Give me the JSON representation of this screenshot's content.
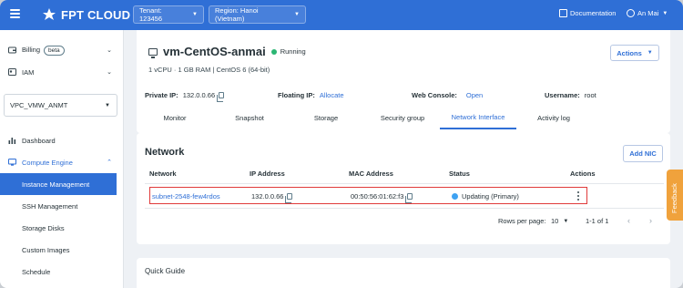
{
  "topbar": {
    "logo_text": "FPT CLOUD",
    "tenant_label": "Tenant: 123456",
    "region_label": "Region: Hanoi (Vietnam)",
    "documentation_label": "Documentation",
    "user_label": "An Mai"
  },
  "sidebar": {
    "billing_label": "Billing",
    "beta_label": "beta",
    "iam_label": "IAM",
    "vpc_value": "VPC_VMW_ANMT",
    "dashboard_label": "Dashboard",
    "compute_engine_label": "Compute Engine",
    "subitems": [
      "Instance Management",
      "SSH Management",
      "Storage Disks",
      "Custom Images",
      "Schedule"
    ]
  },
  "vm": {
    "name": "vm-CentOS-anmai",
    "status": "Running",
    "specs": "1 vCPU · 1 GB RAM | CentOS 6 (64-bit)",
    "actions_label": "Actions",
    "private_ip_label": "Private IP:",
    "private_ip_value": "132.0.0.66",
    "floating_ip_label": "Floating IP:",
    "floating_ip_value": "Allocate",
    "web_console_label": "Web Console:",
    "web_console_value": "Open",
    "username_label": "Username:",
    "username_value": "root"
  },
  "tabs": [
    "Monitor",
    "Snapshot",
    "Storage",
    "Security group",
    "Network Interface",
    "Activity log"
  ],
  "network": {
    "title": "Network",
    "add_nic_label": "Add NIC",
    "headers": [
      "Network",
      "IP Address",
      "MAC Address",
      "Status",
      "Actions"
    ],
    "row": {
      "network": "subnet-2548-few4rdos",
      "ip": "132.0.0.66",
      "mac": "00:50:56:01:62:f3",
      "status": "Updating (Primary)"
    },
    "rows_per_page_label": "Rows per page:",
    "rows_per_page_value": "10",
    "range_label": "1-1 of 1"
  },
  "quick_guide_label": "Quick Guide",
  "feedback_label": "Feedback",
  "colors": {
    "brand_blue": "#2f6fd6",
    "running_green": "#2bb673",
    "updating_blue": "#3ea2f2",
    "highlight_red": "#e03a3a",
    "feedback_orange": "#f0a23c"
  }
}
